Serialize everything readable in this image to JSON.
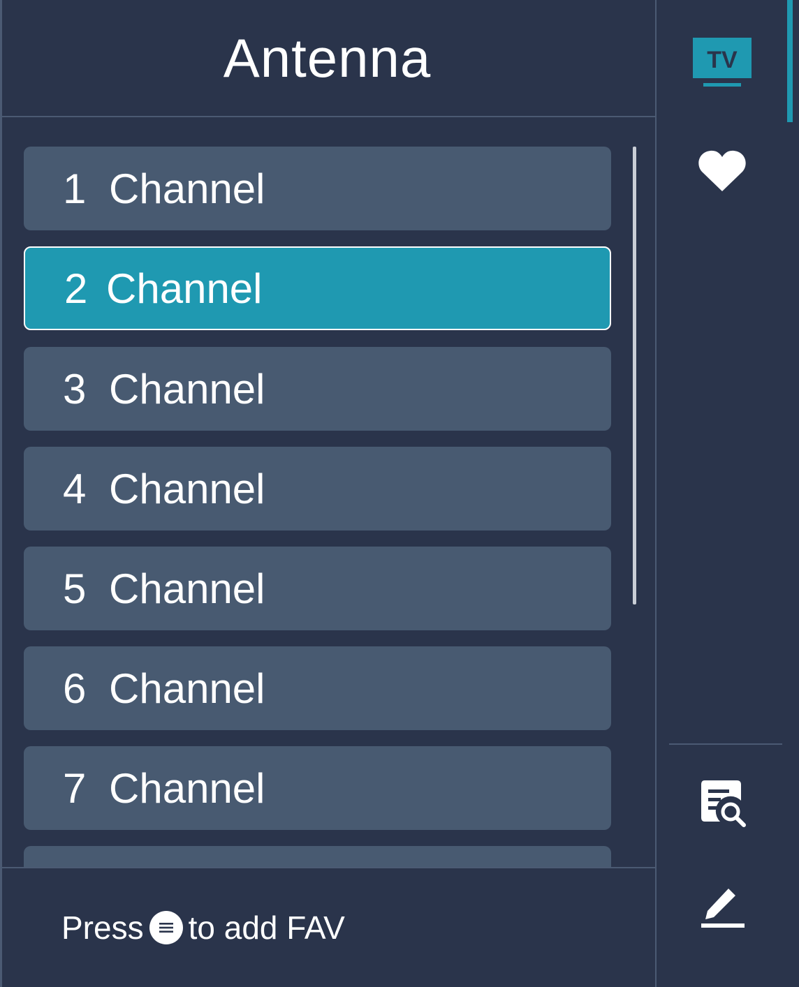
{
  "header": {
    "title": "Antenna"
  },
  "channels": [
    {
      "number": "1",
      "label": "Channel"
    },
    {
      "number": "2",
      "label": "Channel",
      "selected": true
    },
    {
      "number": "3",
      "label": "Channel"
    },
    {
      "number": "4",
      "label": "Channel"
    },
    {
      "number": "5",
      "label": "Channel"
    },
    {
      "number": "6",
      "label": "Channel"
    },
    {
      "number": "7",
      "label": "Channel"
    },
    {
      "number": "",
      "label": ""
    }
  ],
  "footer": {
    "press_text": "Press",
    "menu_icon": "menu-icon",
    "action_text": "to add FAV"
  },
  "side_rail": {
    "items": [
      {
        "icon": "tv-icon",
        "tv_text": "TV",
        "active": true
      },
      {
        "icon": "heart-icon"
      },
      {
        "icon": "search-list-icon"
      },
      {
        "icon": "edit-icon"
      }
    ]
  },
  "colors": {
    "background": "#2a344b",
    "item": "#485a71",
    "accent": "#1f99b1",
    "divider": "#4b5a73"
  }
}
